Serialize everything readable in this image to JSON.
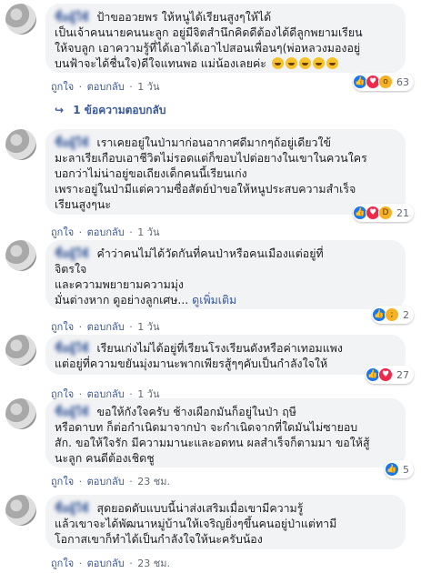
{
  "comments": [
    {
      "name": "ชื่อผู้ใช้",
      "text_lines": [
        "ป้าขออวยพร ให้หนูได้เรียนสูงๆให้ได้",
        "เป็นเจ้าคนนายคนนะลูก อยู่มีจิตสำนึกคิดดีต้องได้ดีลูกพยามเรียน",
        "ให้จบลูก เอาความรู้ที่ได้เอาได้เอาไปสอนเพื่อนๆ(พ่อหลวงมองอยู่",
        "บนฟ้าจะได้ชื่นใจ)ดีใจแทนพอ แม่น้องเลยค่ะ"
      ],
      "emoji_count": 5,
      "actions": [
        "ถูกใจ",
        "ตอบกลับ",
        "1 วัน"
      ],
      "reactions": [
        "like",
        "love",
        "wow"
      ],
      "reaction_count": "63"
    },
    {
      "reply_text": "1 ข้อความตอบกลับ"
    },
    {
      "name": "ชื่อผู้ใช้",
      "text_lines": [
        "เราเคยอยู่ในป่ามาก่อนอากาศดีมากๆถ้อยู่เดียวใข้",
        "มะลาเรียเกือบเอาชีวิตไม่รอดแต่ก็ขอบไปต่อยางในเขาในควนใคร",
        "บอกว่าไม่น่าอยู่ขอเถียงเด็กคนนี้เรียนเก่ง",
        "เพราะอยู่ในป่ามีแต่ความซื่อสัตย์ป่าขอให้หนูประสบความสำเร็จ",
        "เรียนสูงๆนะ"
      ],
      "actions": [
        "ถูกใจ",
        "ตอบกลับ",
        "1 วัน"
      ],
      "reactions": [
        "like",
        "love",
        "haha"
      ],
      "reaction_count": "21"
    },
    {
      "name": "ชื่อผู้ใช้",
      "text_lines": [
        "คำว่าคนไม่ได้วัดกันที่คนป่าหรือคนเมืองแต่อยู่ที่",
        "จิตรใจ",
        "และความพยายามความมุ่ง",
        "มั่นต่างหาก ดูอย่างลูกเศษ..."
      ],
      "see_more": "ดูเพิ่มเติม",
      "actions": [
        "ถูกใจ",
        "ตอบกลับ",
        "1 วัน"
      ],
      "reactions": [
        "like",
        "sad"
      ],
      "reaction_count": "2"
    },
    {
      "name": "ชื่อผู้ใช้",
      "text_lines": [
        "เรียนเก่งไม่ได้อยู่ที่เรียนโรงเรียนดังหรือค่าเทอมแพง",
        "แต่อยู่ที่ความขยันมุ่งมานะพากเพียรสู้ๆๆคับเป็นกำลังใจให้"
      ],
      "actions": [
        "ถูกใจ",
        "ตอบกลับ",
        "1 วัน"
      ],
      "reactions": [
        "like",
        "love"
      ],
      "reaction_count": "27"
    },
    {
      "name": "ชื่อผู้ใช้",
      "text_lines": [
        "ขอให้กังใจครับ ช้างเผือกมันก็อยู่ในป่า ฤษี",
        "หรือดาบท ก็ต่อกำเนิดมาจากป่า จะกำเนิดจากที่ใดมันไม่ซายอบ",
        "สัก. ขอให้ใจรัก มีความมานะและอดทน ผลสำเร็จก็ตามมา ขอให้สู้",
        "นะลูก คนดีต้องเชิดชู"
      ],
      "actions": [
        "ถูกใจ",
        "ตอบกลับ",
        "23 ชม."
      ],
      "reactions": [
        "like"
      ],
      "reaction_count": "5"
    },
    {
      "name": "ชื่อผู้ใช้",
      "text_lines": [
        "สุดยอดดับแบบนี้น่าส่งเสริมเมื่อเขามีความรู้",
        "แล้วเขาจะได้พัฒนาหมู่บ้านให้เจริญยิ่งๆขึ้นคนอยู่ป่าแต่ทามี",
        "โอกาสเขาก็ทำได้เป็นกำลังใจให้นะครับน้อง"
      ],
      "actions": [
        "ถูกใจ",
        "ตอบกลับ",
        "23 ชม."
      ]
    }
  ],
  "colors": {
    "link": "#385898",
    "bubble": "#f2f3f5",
    "like": "#1877f2",
    "love": "#f0284a"
  },
  "separator": "·"
}
